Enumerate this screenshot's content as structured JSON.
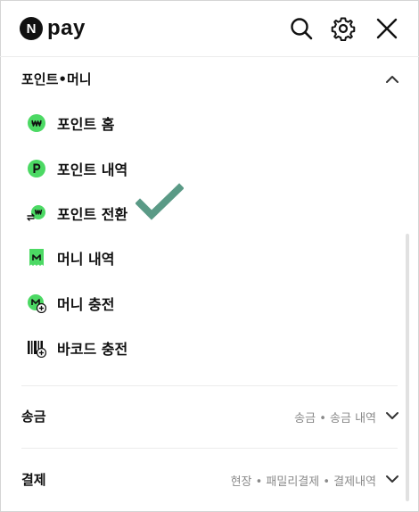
{
  "header": {
    "logo_letter": "N",
    "logo_text": "pay",
    "icons": [
      "search-icon",
      "gear-icon",
      "close-icon"
    ]
  },
  "point_money": {
    "title": "포인트•머니",
    "expanded": true,
    "items": [
      {
        "label": "포인트 홈",
        "icon": "won-coin-icon"
      },
      {
        "label": "포인트 내역",
        "icon": "p-coin-icon"
      },
      {
        "label": "포인트 전환",
        "icon": "exchange-won-icon"
      },
      {
        "label": "머니 내역",
        "icon": "money-receipt-icon"
      },
      {
        "label": "머니 충전",
        "icon": "money-charge-icon"
      },
      {
        "label": "바코드 충전",
        "icon": "barcode-charge-icon"
      }
    ]
  },
  "transfer": {
    "title": "송금",
    "subtitle": "송금 • 송금 내역"
  },
  "payment": {
    "title": "결제",
    "subtitle": "현장 • 패밀리결제 • 결제내역"
  },
  "colors": {
    "accent_green": "#4cd964",
    "check_green": "#5a9a86",
    "text": "#111111",
    "muted": "#8a8a8a"
  }
}
